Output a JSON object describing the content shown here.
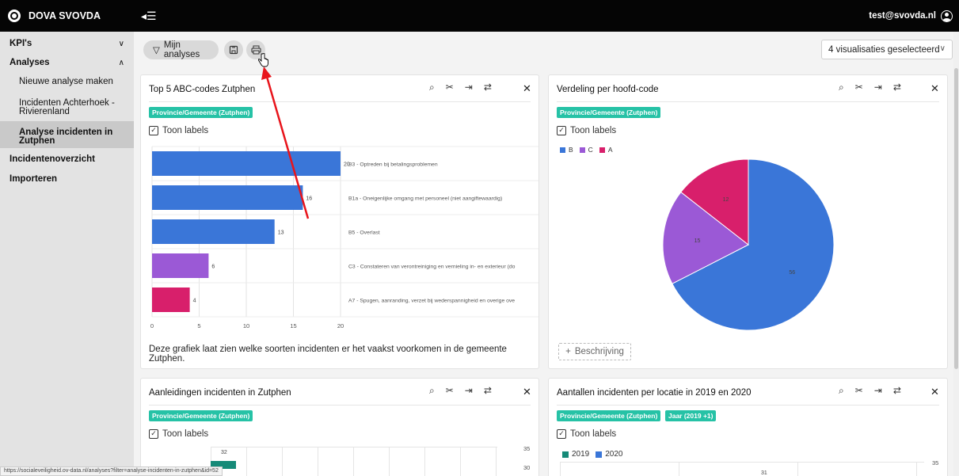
{
  "app": {
    "brand": "DOVA SVOVDA",
    "user_email": "test@svovda.nl"
  },
  "sidebar": {
    "sections": [
      {
        "label": "KPI's",
        "chevron": "∨"
      },
      {
        "label": "Analyses",
        "chevron": "∧"
      }
    ],
    "sub_items": [
      {
        "label": "Nieuwe analyse maken"
      },
      {
        "label": "Incidenten Achterhoek - Rivierenland"
      },
      {
        "label": "Analyse incidenten in Zutphen"
      }
    ],
    "items": [
      {
        "label": "Incidentenoverzicht"
      },
      {
        "label": "Importeren"
      }
    ]
  },
  "toolbar": {
    "my_analyses_label": "Mijn analyses",
    "selection_label": "4 visualisaties geselecteerd"
  },
  "cards": {
    "top5": {
      "title": "Top 5 ABC-codes Zutphen",
      "tag": "Provincie/Gemeente (Zutphen)",
      "checkbox_label": "Toon labels",
      "description": "Deze grafiek laat zien welke soorten incidenten er het vaakst voorkomen in de gemeente Zutphen."
    },
    "verdeling": {
      "title": "Verdeling per hoofd-code",
      "tag": "Provincie/Gemeente (Zutphen)",
      "checkbox_label": "Toon labels",
      "add_description_label": "Beschrijving"
    },
    "aanleidingen": {
      "title": "Aanleidingen incidenten in Zutphen",
      "tag": "Provincie/Gemeente (Zutphen)",
      "checkbox_label": "Toon labels"
    },
    "aantallen": {
      "title": "Aantallen incidenten per locatie in 2019 en 2020",
      "tag": "Provincie/Gemeente (Zutphen)",
      "tag2": "Jaar (2019 +1)",
      "checkbox_label": "Toon labels"
    }
  },
  "status_url": "https://socialeveiligheid.ov-data.nl/analyses?filter=analyse-incidenten-in-zutphen&id=52",
  "colors": {
    "blue": "#3a76d8",
    "purple": "#9b59d6",
    "pink": "#d81f6b",
    "teal": "#26c2a6",
    "green": "#168a78",
    "arrow": "#e8141b"
  },
  "chart_data": [
    {
      "type": "bar",
      "orientation": "horizontal",
      "categories": [
        "B3 - Optreden bij betalingsproblemen",
        "B1a - Oneigenlijke omgang met personeel (niet aangiftewaardig)",
        "B5 - Overlast",
        "C3 - Constateren van verontreiniging en vernieling in- en exterieur (do",
        "A7 - Spugen, aanranding, verzet bij wederspannigheid en overige ove"
      ],
      "values": [
        20,
        16,
        13,
        6,
        4
      ],
      "value_labels": [
        "20",
        "16",
        "13",
        "6",
        "4"
      ],
      "xticks": [
        "0",
        "5",
        "10",
        "15",
        "20"
      ],
      "xlim": [
        0,
        20
      ]
    },
    {
      "type": "pie",
      "legend": [
        "B",
        "C",
        "A"
      ],
      "values": [
        56,
        15,
        12
      ],
      "value_labels": [
        "56",
        "15",
        "12"
      ]
    },
    {
      "type": "bar",
      "values": [
        32
      ],
      "value_labels": [
        "32"
      ],
      "yticks": [
        "35",
        "30"
      ]
    },
    {
      "type": "bar",
      "legend": [
        "2019",
        "2020"
      ],
      "values": [
        31
      ],
      "value_labels": [
        "31"
      ],
      "yticks": [
        "35"
      ]
    }
  ]
}
